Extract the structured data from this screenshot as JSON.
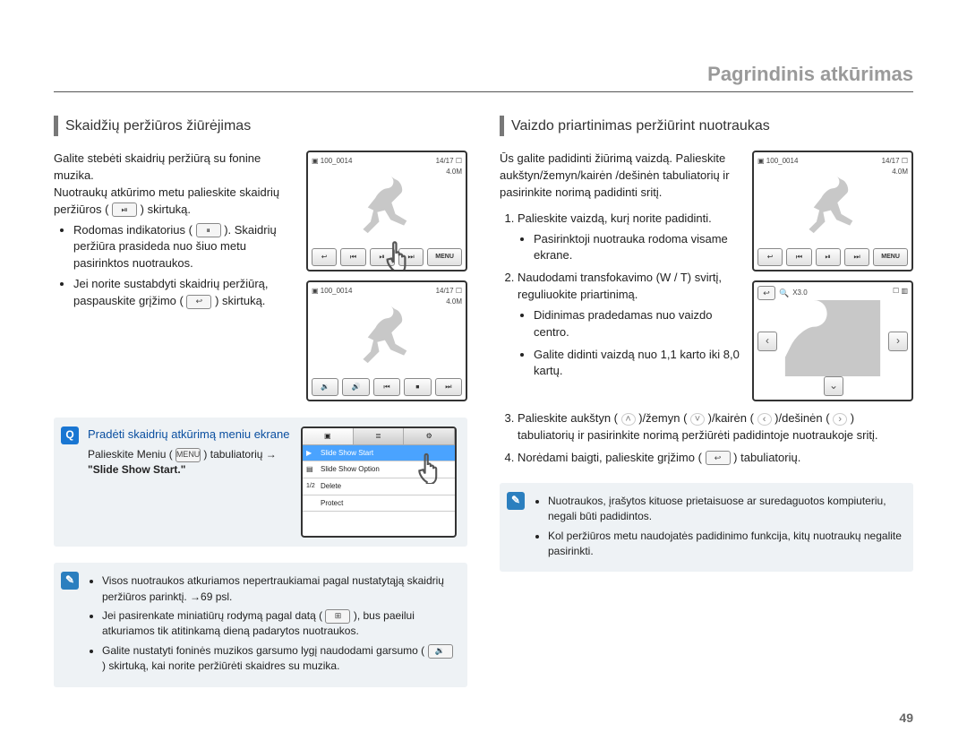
{
  "page": {
    "title": "Pagrindinis atkūrimas",
    "number": "49"
  },
  "left": {
    "heading": "Skaidžių peržiūros žiūrėjimas",
    "p1": "Galite stebėti skaidrių peržiūrą su fonine muzika.",
    "p2a": "Nuotraukų atkūrimo metu palieskite skaidrių peržiūros (",
    "p2b": ") skirtuką.",
    "b1a": "Rodomas indikatorius (",
    "b1b": "). Skaidrių peržiūra prasideda nuo šiuo metu pasirinktos nuotraukos.",
    "b2a": "Jei norite sustabdyti skaidrių peržiūrą, paspauskite grįžimo (",
    "b2b": ") skirtuką.",
    "tip": {
      "title": "Pradėti skaidrių atkūrimą meniu ekrane",
      "line1a": "Palieskite Meniu (",
      "line1b": ") tabuliatorių →",
      "line2": "\"Slide Show Start.\"",
      "menu_items": {
        "r1": "Slide Show Start",
        "r2": "Slide Show Option",
        "r3": "Delete",
        "r4": "Protect",
        "pager": "1/2"
      }
    },
    "note": {
      "n1": "Visos nuotraukos atkuriamos nepertraukiamai pagal nustatytąją skaidrių peržiūros parinktį. →69 psl.",
      "n2a": "Jei pasirenkate miniatiūrų rodymą pagal datą (",
      "n2b": "), bus paeilui atkuriamos tik atitinkamą dieną padarytos nuotraukos.",
      "n3a": "Galite nustatyti foninės muzikos garsumo lygį naudodami garsumo (",
      "n3b": ") skirtuką, kai norite peržiūrėti skaidres su muzika."
    },
    "lcd1": {
      "topLeftA": "▣",
      "topLeftB": "100_0014",
      "topRightA": "14/17",
      "topRightB": "☐",
      "topRightC": "4.0M",
      "bot": {
        "back": "↩",
        "prev": "⏮",
        "play": "⏯",
        "next": "⏭",
        "menu": "MENU"
      }
    },
    "lcd2": {
      "topLeftA": "▣",
      "topLeftB": "100_0014",
      "topRightA": "14/17",
      "topRightB": "☐",
      "topRightC": "4.0M",
      "bot": {
        "vdn": "🔉",
        "vup": "🔊",
        "prev": "⏮",
        "stop": "⏹",
        "next": "⏭"
      }
    }
  },
  "right": {
    "heading": "Vaizdo priartinimas peržiūrint nuotraukas",
    "p1": "Ūs galite padidinti žiūrimą vaizdą. Palieskite aukštyn/žemyn/kairėn /dešinėn tabuliatorių ir pasirinkite norimą padidinti sritį.",
    "li1": "Palieskite vaizdą, kurį norite padidinti.",
    "li1_s1": "Pasirinktoji nuotrauka rodoma visame ekrane.",
    "li2": "Naudodami transfokavimo (W / T) svirtį, reguliuokite priartinimą.",
    "li2_s1": "Didinimas pradedamas nuo vaizdo centro.",
    "li2_s2": "Galite didinti vaizdą nuo 1,1 karto iki 8,0 kartų.",
    "li3a": "Palieskite aukštyn ( ",
    "li3b": " )/žemyn ( ",
    "li3c": " )/kairėn ( ",
    "li3d": " )/dešinėn ( ",
    "li3e": " ) tabuliatorių ir pasirinkite norimą peržiūrėti padidintoje nuotraukoje sritį.",
    "li4a": "Norėdami baigti, palieskite grįžimo (",
    "li4b": ") tabuliatorių.",
    "note": {
      "n1": "Nuotraukos, įrašytos kituose prietaisuose ar suredaguotos kompiuteriu, negali būti padidintos.",
      "n2": "Kol peržiūros metu naudojatės padidinimo funkcija, kitų nuotraukų negalite pasirinkti."
    },
    "lcd1": {
      "topLeftA": "▣",
      "topLeftB": "100_0014",
      "topRightA": "14/17",
      "topRightB": "☐",
      "topRightC": "4.0M",
      "bot": {
        "back": "↩",
        "prev": "⏮",
        "play": "⏯",
        "next": "⏭",
        "menu": "MENU"
      }
    },
    "lcd2": {
      "zoom": "X3.0",
      "back": "↩"
    }
  }
}
